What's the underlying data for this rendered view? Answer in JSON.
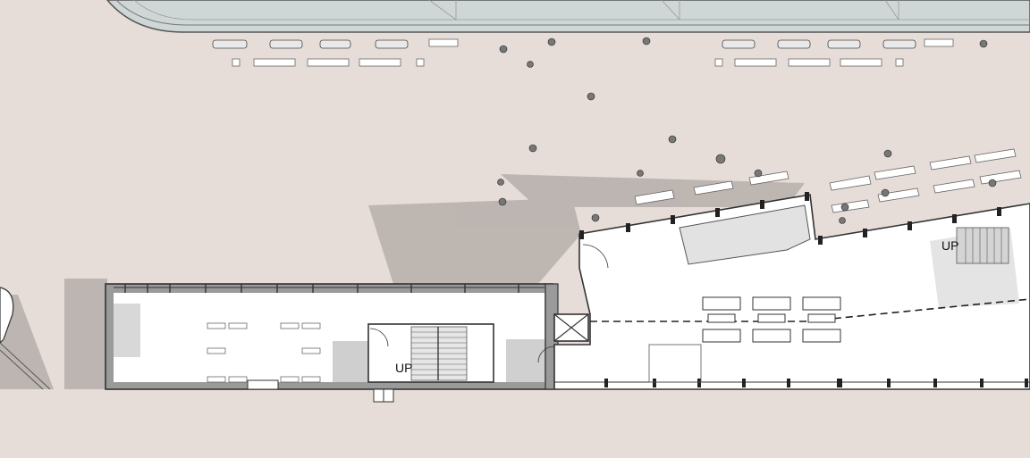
{
  "labels": {
    "stair_up_left": "UP",
    "stair_up_right": "UP"
  }
}
